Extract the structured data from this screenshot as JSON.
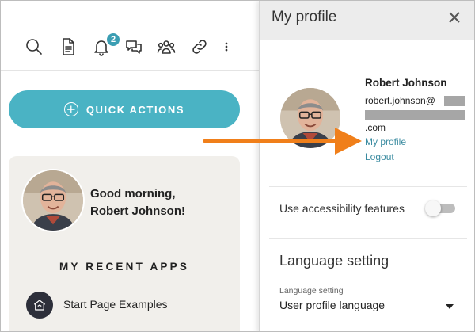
{
  "toolbar": {
    "icons": [
      "search-icon",
      "document-icon",
      "bell-icon",
      "chat-icon",
      "people-icon",
      "link-icon",
      "more-icon"
    ],
    "notification_count": "2"
  },
  "quick_actions": {
    "label": "QUICK ACTIONS",
    "icon": "plus-circle-icon"
  },
  "welcome_card": {
    "greeting_line1": "Good morning,",
    "greeting_line2": "Robert Johnson!",
    "recent_apps_title": "MY RECENT APPS",
    "apps": [
      {
        "label": "Start Page Examples",
        "icon": "home-icon"
      }
    ]
  },
  "profile_panel": {
    "title": "My profile",
    "name": "Robert Johnson",
    "email_prefix": "robert.johnson@",
    "email_suffix": ".com",
    "my_profile_link": "My profile",
    "logout_link": "Logout",
    "accessibility_label": "Use accessibility features",
    "accessibility_enabled": false,
    "language_heading": "Language setting",
    "language_field_label": "Language setting",
    "language_value": "User profile language"
  },
  "colors": {
    "accent": "#4ab3c4",
    "link": "#3a8ba0",
    "arrow": "#f07f1a",
    "badge": "#3b9eb3"
  }
}
